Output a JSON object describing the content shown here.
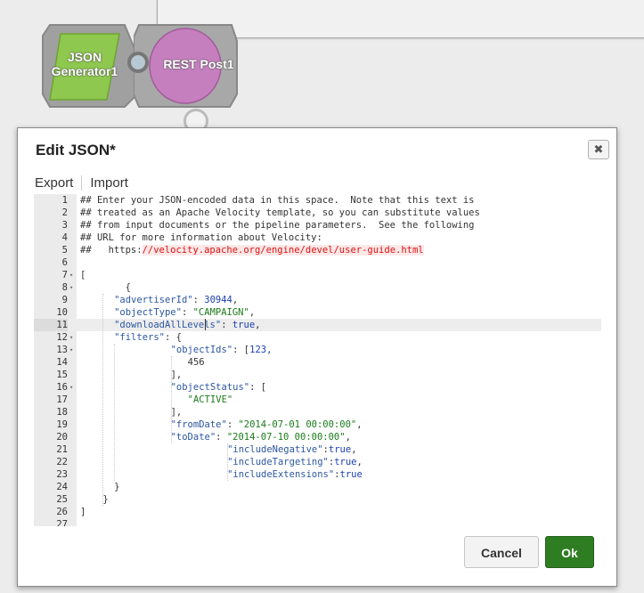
{
  "canvas": {
    "snaps": {
      "json_generator": {
        "label": "JSON Generator1",
        "label_line1": "JSON",
        "label_line2": "Generator1",
        "color": "#8fc84e"
      },
      "rest_post": {
        "label": "REST Post1",
        "color": "#c074b8"
      }
    }
  },
  "dialog": {
    "title": "Edit JSON*",
    "close_icon": "close-icon",
    "toolbar": {
      "export_label": "Export",
      "import_label": "Import"
    },
    "editor": {
      "active_line": 11,
      "lines": [
        {
          "n": "1",
          "fold": "",
          "text": "## Enter your JSON-encoded data in this space.  Note that this text is"
        },
        {
          "n": "2",
          "fold": "",
          "text": "## treated as an Apache Velocity template, so you can substitute values"
        },
        {
          "n": "3",
          "fold": "",
          "text": "## from input documents or the pipeline parameters.  See the following"
        },
        {
          "n": "4",
          "fold": "",
          "text": "## URL for more information about Velocity:"
        },
        {
          "n": "5",
          "fold": "",
          "text": "##   https:",
          "url": "//velocity.apache.org/engine/devel/user-guide.html"
        },
        {
          "n": "6",
          "fold": "",
          "text": ""
        },
        {
          "n": "7",
          "fold": "▾",
          "text": "["
        },
        {
          "n": "8",
          "fold": "▾",
          "text": "    {"
        },
        {
          "n": "9",
          "fold": "",
          "key": "\"advertiserId\"",
          "sep": ": ",
          "val": "30944",
          "vt": "num",
          "tail": ","
        },
        {
          "n": "10",
          "fold": "",
          "key": "\"objectType\"",
          "sep": ": ",
          "val": "\"CAMPAIGN\"",
          "vt": "str",
          "tail": ","
        },
        {
          "n": "11",
          "fold": "",
          "key": "\"downloadAllLevels\"",
          "sep": ": ",
          "val": "true",
          "vt": "bool",
          "tail": ","
        },
        {
          "n": "12",
          "fold": "▾",
          "key": "\"filters\"",
          "sep": ": ",
          "val": "",
          "vt": "",
          "tail": "{"
        },
        {
          "n": "13",
          "fold": "▾",
          "key": "\"objectIds\"",
          "sep": ": ",
          "val": "[123,",
          "vt": "num",
          "tail": ""
        },
        {
          "n": "14",
          "fold": "",
          "text": "456"
        },
        {
          "n": "15",
          "fold": "",
          "text": "],"
        },
        {
          "n": "16",
          "fold": "▾",
          "key": "\"objectStatus\"",
          "sep": ": ",
          "val": "[",
          "vt": "",
          "tail": ""
        },
        {
          "n": "17",
          "fold": "",
          "key": "",
          "sep": "",
          "val": "\"ACTIVE\"",
          "vt": "str",
          "tail": ""
        },
        {
          "n": "18",
          "fold": "",
          "text": "],"
        },
        {
          "n": "19",
          "fold": "",
          "key": "\"fromDate\"",
          "sep": ": ",
          "val": "\"2014-07-01 00:00:00\"",
          "vt": "str",
          "tail": ","
        },
        {
          "n": "20",
          "fold": "",
          "key": "\"toDate\"",
          "sep": ": ",
          "val": "\"2014-07-10 00:00:00\"",
          "vt": "str",
          "tail": ","
        },
        {
          "n": "21",
          "fold": "",
          "key": "\"includeNegative\"",
          "sep": ":",
          "val": "true",
          "vt": "bool",
          "tail": ","
        },
        {
          "n": "22",
          "fold": "",
          "key": "\"includeTargeting\"",
          "sep": ":",
          "val": "true",
          "vt": "bool",
          "tail": ","
        },
        {
          "n": "23",
          "fold": "",
          "key": "\"includeExtensions\"",
          "sep": ":",
          "val": "true",
          "vt": "bool",
          "tail": ""
        },
        {
          "n": "24",
          "fold": "",
          "text": "}"
        },
        {
          "n": "25",
          "fold": "",
          "text": "}"
        },
        {
          "n": "26",
          "fold": "",
          "text": "]"
        },
        {
          "n": "27",
          "fold": "",
          "text": ""
        }
      ]
    },
    "buttons": {
      "cancel_label": "Cancel",
      "ok_label": "Ok",
      "ok_color": "#2e7d22"
    }
  }
}
